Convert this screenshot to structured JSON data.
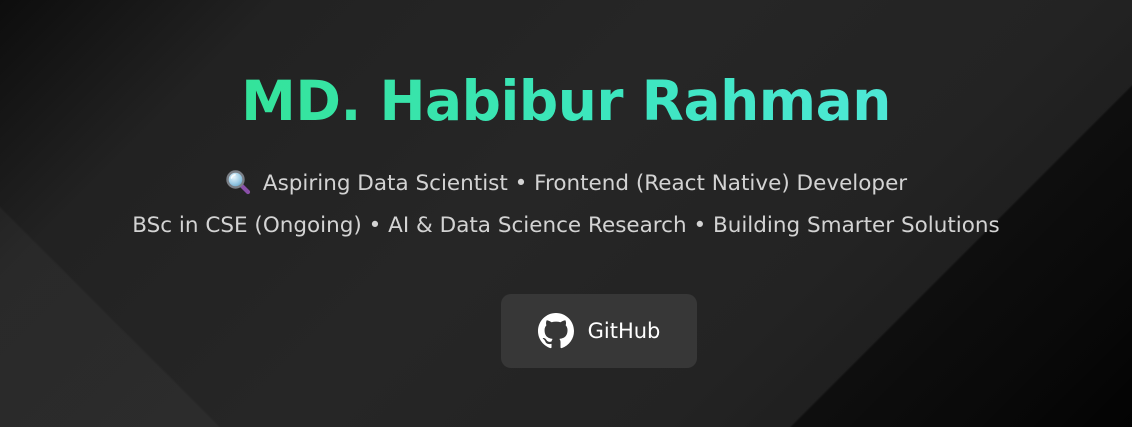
{
  "profile": {
    "name": "MD. Habibur Rahman",
    "tagline_icon": "magnifying-glass-icon",
    "tagline": "Aspiring Data Scientist • Frontend (React Native) Developer",
    "subline": "BSc in CSE (Ongoing) • AI & Data Science Research • Building Smarter Solutions"
  },
  "links": {
    "github_icon": "github-icon",
    "github_label": "GitHub"
  },
  "colors": {
    "name_gradient_start": "#34e39a",
    "name_gradient_end": "#4ee8d6",
    "text": "#d3d3d3",
    "button_bg": "#373737",
    "background": "#242424"
  }
}
